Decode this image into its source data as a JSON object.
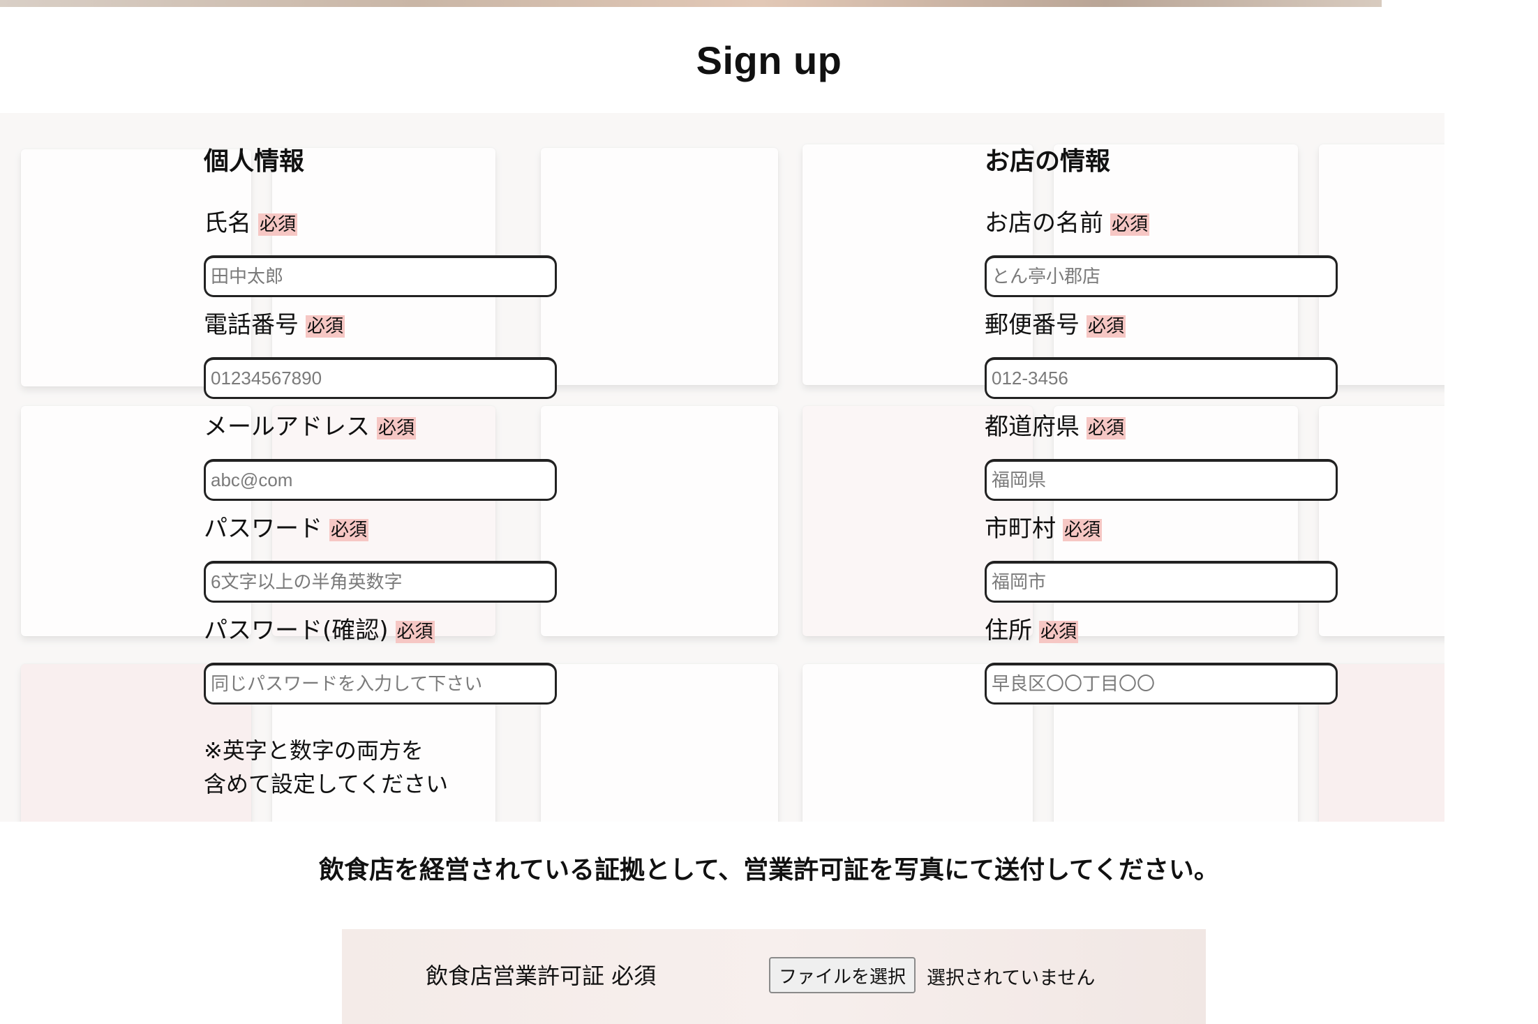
{
  "page": {
    "title": "Sign up"
  },
  "personal": {
    "heading": "個人情報",
    "fields": [
      {
        "label": "氏名",
        "required": "必須",
        "placeholder": "田中太郎"
      },
      {
        "label": "電話番号",
        "required": "必須",
        "placeholder": "01234567890"
      },
      {
        "label": "メールアドレス",
        "required": "必須",
        "placeholder": "abc@com"
      },
      {
        "label": "パスワード",
        "required": "必須",
        "placeholder": "6文字以上の半角英数字"
      },
      {
        "label": "パスワード(確認)",
        "required": "必須",
        "placeholder": "同じパスワードを入力して下さい"
      }
    ],
    "note_line1": "※英字と数字の両方を",
    "note_line2": "含めて設定してください"
  },
  "store": {
    "heading": "お店の情報",
    "fields": [
      {
        "label": "お店の名前",
        "required": "必須",
        "placeholder": "とん亭小郡店"
      },
      {
        "label": "郵便番号",
        "required": "必須",
        "placeholder": "012-3456"
      },
      {
        "label": "都道府県",
        "required": "必須",
        "placeholder": "福岡県"
      },
      {
        "label": "市町村",
        "required": "必須",
        "placeholder": "福岡市"
      },
      {
        "label": "住所",
        "required": "必須",
        "placeholder": "早良区〇〇丁目〇〇"
      }
    ]
  },
  "license": {
    "notice": "飲食店を経営されている証拠として、営業許可証を写真にて送付してください。",
    "label": "飲食店営業許可証 必須",
    "button": "ファイルを選択",
    "status": "選択されていません"
  }
}
